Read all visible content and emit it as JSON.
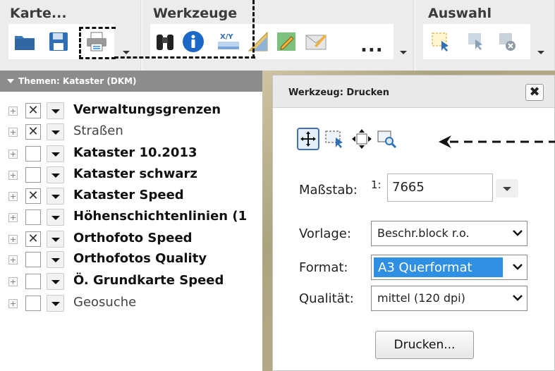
{
  "toolbar": {
    "groups": [
      {
        "title": "Karte...",
        "icons": [
          "folder-icon",
          "save-icon",
          "printer-icon"
        ]
      },
      {
        "title": "Werkzeuge",
        "icons": [
          "binoculars-icon",
          "info-icon",
          "coordinates-icon",
          "ruler-icon",
          "edit-icon",
          "envelope-icon"
        ],
        "more": "..."
      },
      {
        "title": "Auswahl",
        "icons": [
          "select-rectangle-icon",
          "select-remove-icon",
          "clear-selection-icon"
        ]
      }
    ]
  },
  "colors": {
    "accent": "#2f8fe3",
    "panel_header": "#8c8c8c",
    "info_blue": "#1d68c7"
  },
  "panel": {
    "header": "Themen: Kataster (DKM)",
    "layers": [
      {
        "label": "Verwaltungsgrenzen",
        "checked": true,
        "bold": true
      },
      {
        "label": "Straßen",
        "checked": true,
        "bold": false
      },
      {
        "label": "Kataster 10.2013",
        "checked": false,
        "bold": true
      },
      {
        "label": "Kataster schwarz",
        "checked": false,
        "bold": true
      },
      {
        "label": "Kataster Speed",
        "checked": true,
        "bold": true
      },
      {
        "label": "Höhenschichtenlinien (1",
        "checked": false,
        "bold": true
      },
      {
        "label": "Orthofoto Speed",
        "checked": true,
        "bold": true
      },
      {
        "label": "Orthofotos Quality",
        "checked": false,
        "bold": true
      },
      {
        "label": "Ö. Grundkarte Speed",
        "checked": false,
        "bold": true
      },
      {
        "label": "Geosuche",
        "checked": false,
        "bold": false
      }
    ],
    "check_mark": "✕"
  },
  "dialog": {
    "title": "Werkzeug: Drucken",
    "close": "✖",
    "tools": [
      "move-icon",
      "select-frame-icon",
      "pan-arrows-icon",
      "zoom-rectangle-icon"
    ],
    "scale_label": "Maßstab:",
    "scale_prefix": "1:",
    "scale_value": "7665",
    "template_label": "Vorlage:",
    "template_value": "Beschr.block r.o.",
    "format_label": "Format:",
    "format_value": "A3 Querformat",
    "quality_label": "Qualität:",
    "quality_value": "mittel (120 dpi)",
    "print_button": "Drucken..."
  }
}
